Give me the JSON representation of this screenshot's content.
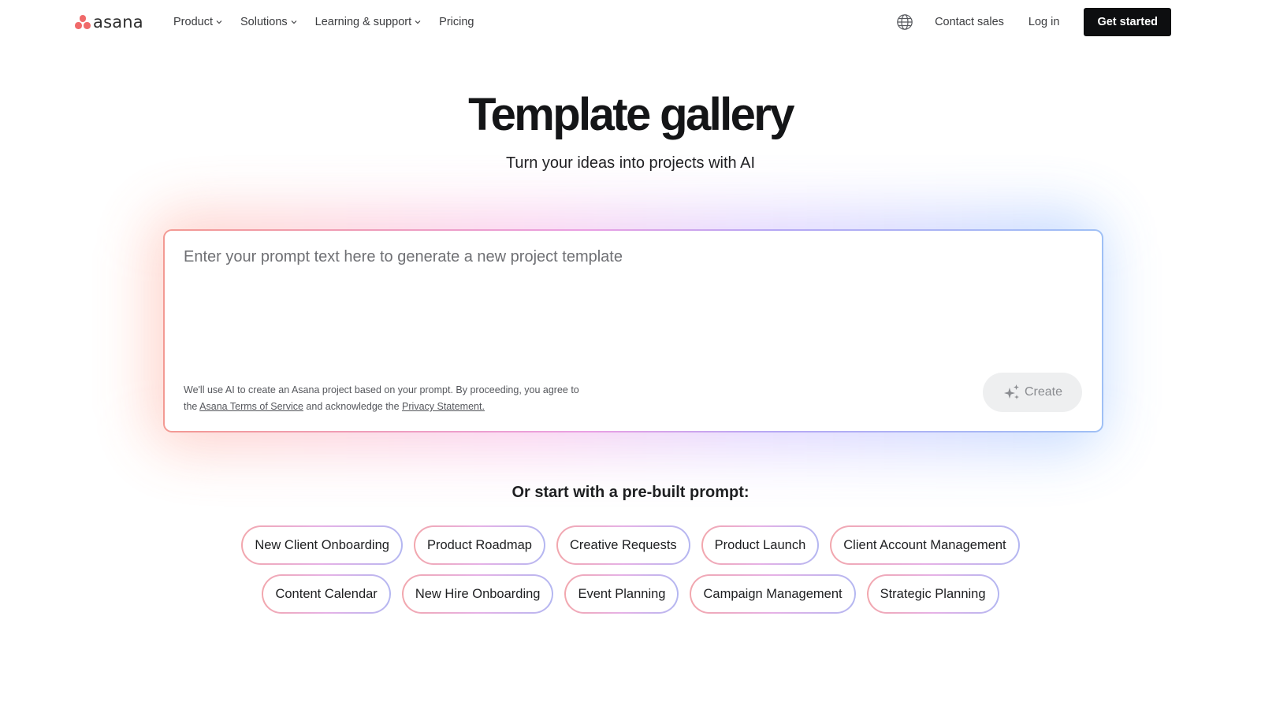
{
  "header": {
    "logo_text": "asana",
    "nav": [
      {
        "label": "Product",
        "has_dropdown": true
      },
      {
        "label": "Solutions",
        "has_dropdown": true
      },
      {
        "label": "Learning & support",
        "has_dropdown": true
      },
      {
        "label": "Pricing",
        "has_dropdown": false
      }
    ],
    "globe_icon": "globe-icon",
    "contact_sales": "Contact sales",
    "log_in": "Log in",
    "get_started": "Get started"
  },
  "hero": {
    "title": "Template gallery",
    "subtitle": "Turn your ideas into projects with AI"
  },
  "prompt": {
    "placeholder": "Enter your prompt text here to generate a new project template",
    "value": "",
    "disclaimer_pre": "We'll use AI to create an Asana project based on your prompt. By proceeding, you agree to the ",
    "terms_link": "Asana Terms of Service",
    "disclaimer_mid": " and acknowledge the ",
    "privacy_link": "Privacy Statement.",
    "create_label": "Create",
    "create_icon": "sparkle-icon"
  },
  "prebuilt": {
    "title": "Or start with a pre-built prompt:",
    "row1": [
      "New Client Onboarding",
      "Product Roadmap",
      "Creative Requests",
      "Product Launch",
      "Client Account Management"
    ],
    "row2": [
      "Content Calendar",
      "New Hire Onboarding",
      "Event Planning",
      "Campaign Management",
      "Strategic Planning"
    ]
  },
  "colors": {
    "brand_coral": "#f06a6a",
    "cta_black": "#0d0e10"
  }
}
